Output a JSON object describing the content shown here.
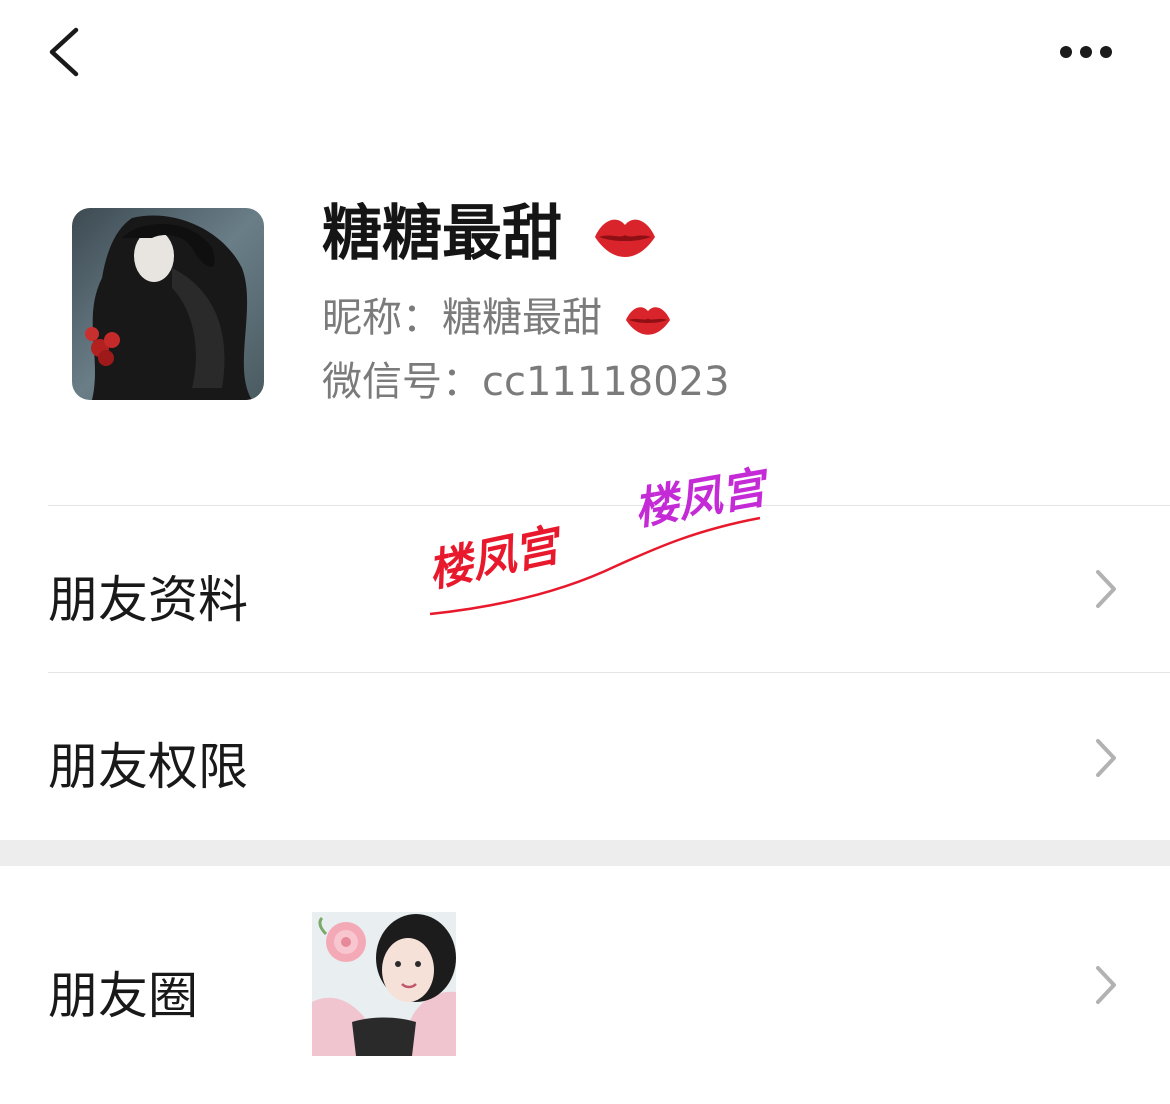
{
  "header": {
    "back_icon": "chevron-left-icon",
    "more_icon": "more-horizontal-icon"
  },
  "profile": {
    "display_name": "糖糖最甜",
    "nickname_text": "昵称：糖糖最甜",
    "wechat_id_text": "微信号：cc11118023",
    "emoji_icon": "kiss-lips-icon"
  },
  "menu": {
    "friend_info": "朋友资料",
    "friend_permissions": "朋友权限",
    "moments": "朋友圈"
  },
  "watermark": {
    "text_red": "楼凤宫",
    "text_purple": "楼凤宫"
  },
  "colors": {
    "background": "#ffffff",
    "section_gap": "#ededed",
    "divider": "#e5e5e5",
    "secondary_text": "#7b7b7b",
    "chevron": "#b2b2b2"
  }
}
